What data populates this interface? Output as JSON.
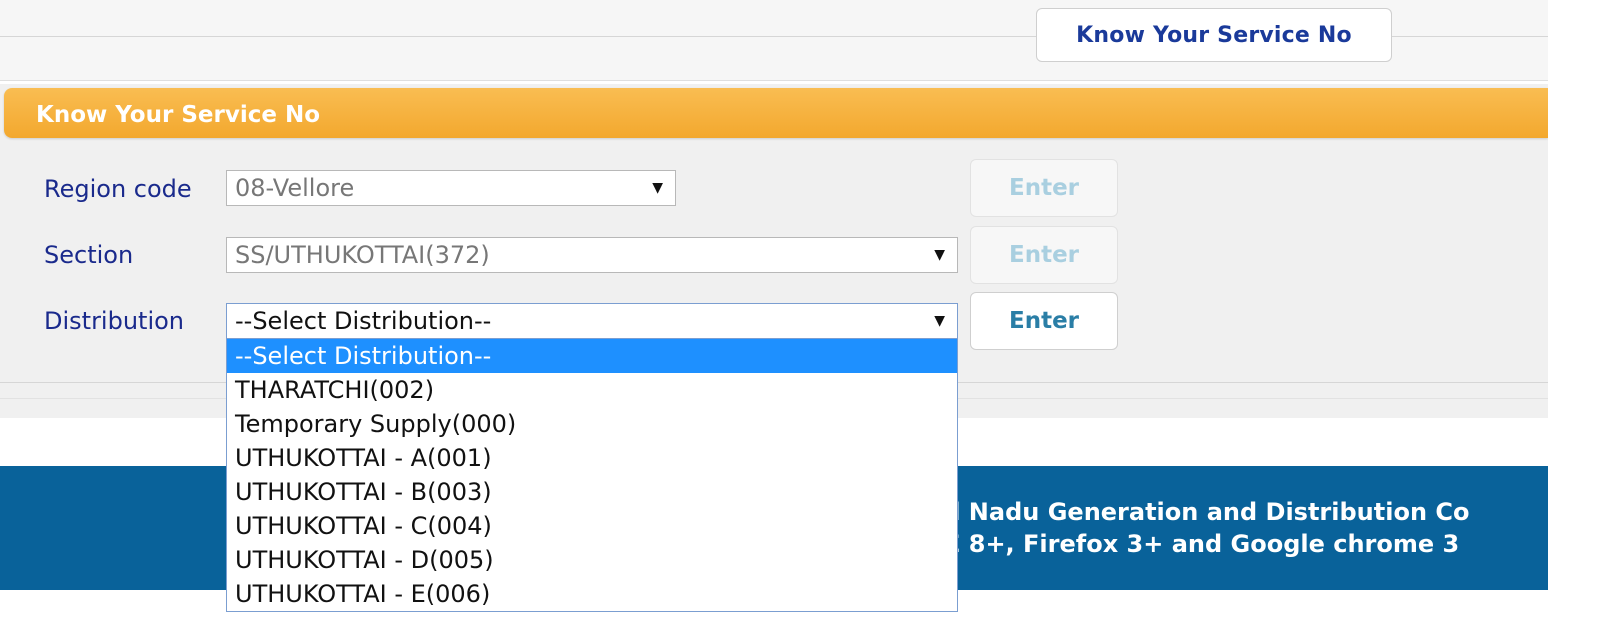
{
  "nav": {
    "tab_label": "Know Your Service No"
  },
  "panel": {
    "title": "Know Your Service No"
  },
  "form": {
    "region": {
      "label": "Region code",
      "value": "08-Vellore",
      "enter_label": "Enter"
    },
    "section": {
      "label": "Section",
      "value": "SS/UTHUKOTTAI(372)",
      "enter_label": "Enter"
    },
    "distribution": {
      "label": "Distribution",
      "value": "--Select Distribution--",
      "enter_label": "Enter",
      "options": [
        "--Select Distribution--",
        "THARATCHI(002)",
        "Temporary Supply(000)",
        "UTHUKOTTAI - A(001)",
        "UTHUKOTTAI - B(003)",
        "UTHUKOTTAI - C(004)",
        "UTHUKOTTAI - D(005)",
        "UTHUKOTTAI - E(006)"
      ]
    }
  },
  "footer": {
    "line1": "il Nadu Generation and Distribution Co",
    "line2": "E 8+, Firefox 3+ and Google chrome 3"
  },
  "colors": {
    "header_orange": "#f3a82e",
    "label_blue": "#1a2a8c",
    "footer_blue": "#09629a",
    "selected_option": "#1e90ff",
    "enter_active": "#2a7ea6",
    "enter_disabled": "#a9cfe0"
  },
  "icons": {
    "dropdown_arrow": "▼"
  }
}
